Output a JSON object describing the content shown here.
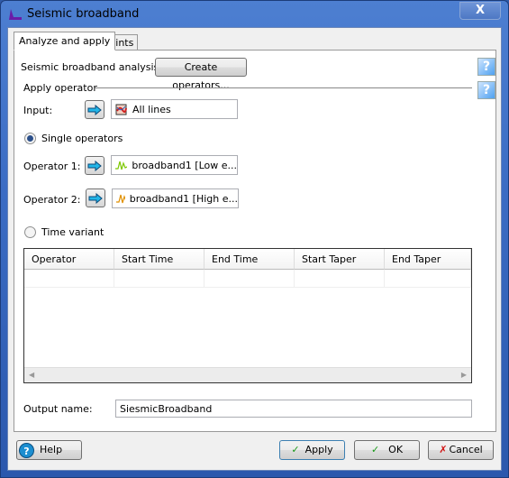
{
  "window": {
    "title": "Seismic broadband",
    "close_label": "X"
  },
  "tabs": [
    {
      "label": "Analyze and apply",
      "active": true
    },
    {
      "label": "Hints",
      "active": false
    }
  ],
  "analysis": {
    "label": "Seismic broadband analysis:",
    "button": "Create operators..."
  },
  "apply": {
    "section": "Apply operator",
    "input_label": "Input:",
    "input_value": "All lines"
  },
  "modes": {
    "single": {
      "label": "Single operators",
      "selected": true
    },
    "time_variant": {
      "label": "Time variant",
      "selected": false
    }
  },
  "operators": [
    {
      "label": "Operator 1:",
      "value": "broadband1 [Low e...",
      "icon_color": "#7dc800"
    },
    {
      "label": "Operator 2:",
      "value": "broadband1 [High e...",
      "icon_color": "#e09000"
    }
  ],
  "table": {
    "columns": [
      "Operator",
      "Start Time",
      "End Time",
      "Start Taper",
      "End Taper"
    ]
  },
  "output": {
    "label": "Output  name:",
    "value": "SiesmicBroadband"
  },
  "footer": {
    "help": "Help",
    "apply": "Apply",
    "ok": "OK",
    "cancel": "Cancel"
  }
}
